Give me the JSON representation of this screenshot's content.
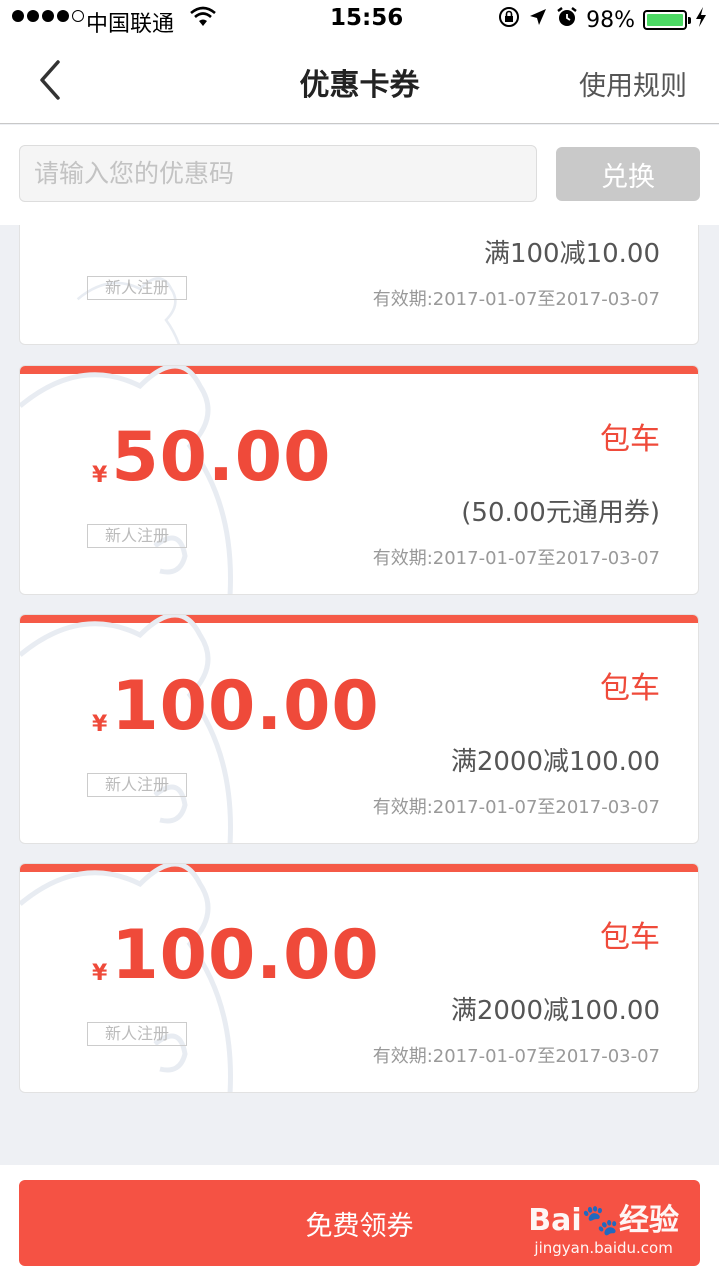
{
  "status_bar": {
    "carrier": "中国联通",
    "time": "15:56",
    "battery": "98%",
    "battery_level": 0.98
  },
  "nav": {
    "title": "优惠卡券",
    "rules_label": "使用规则"
  },
  "redeem": {
    "placeholder": "请输入您的优惠码",
    "button_label": "兑换"
  },
  "coupons": [
    {
      "amount": "",
      "category": "",
      "rule": "满100减10.00",
      "tag": "新人注册",
      "validity": "有效期:2017-01-07至2017-03-07"
    },
    {
      "currency": "¥",
      "amount": "50.00",
      "category": "包车",
      "rule": "(50.00元通用券)",
      "tag": "新人注册",
      "validity": "有效期:2017-01-07至2017-03-07"
    },
    {
      "currency": "¥",
      "amount": "100.00",
      "category": "包车",
      "rule": "满2000减100.00",
      "tag": "新人注册",
      "validity": "有效期:2017-01-07至2017-03-07"
    },
    {
      "currency": "¥",
      "amount": "100.00",
      "category": "包车",
      "rule": "满2000减100.00",
      "tag": "新人注册",
      "validity": "有效期:2017-01-07至2017-03-07"
    }
  ],
  "bottom": {
    "claim_label": "免费领券"
  },
  "watermark": {
    "brand": "Bai🐾经验",
    "url": "jingyan.baidu.com"
  },
  "colors": {
    "accent": "#f55244",
    "price": "#ef4a3a",
    "disabled_button": "#c9c9c9",
    "battery": "#4cd964"
  }
}
